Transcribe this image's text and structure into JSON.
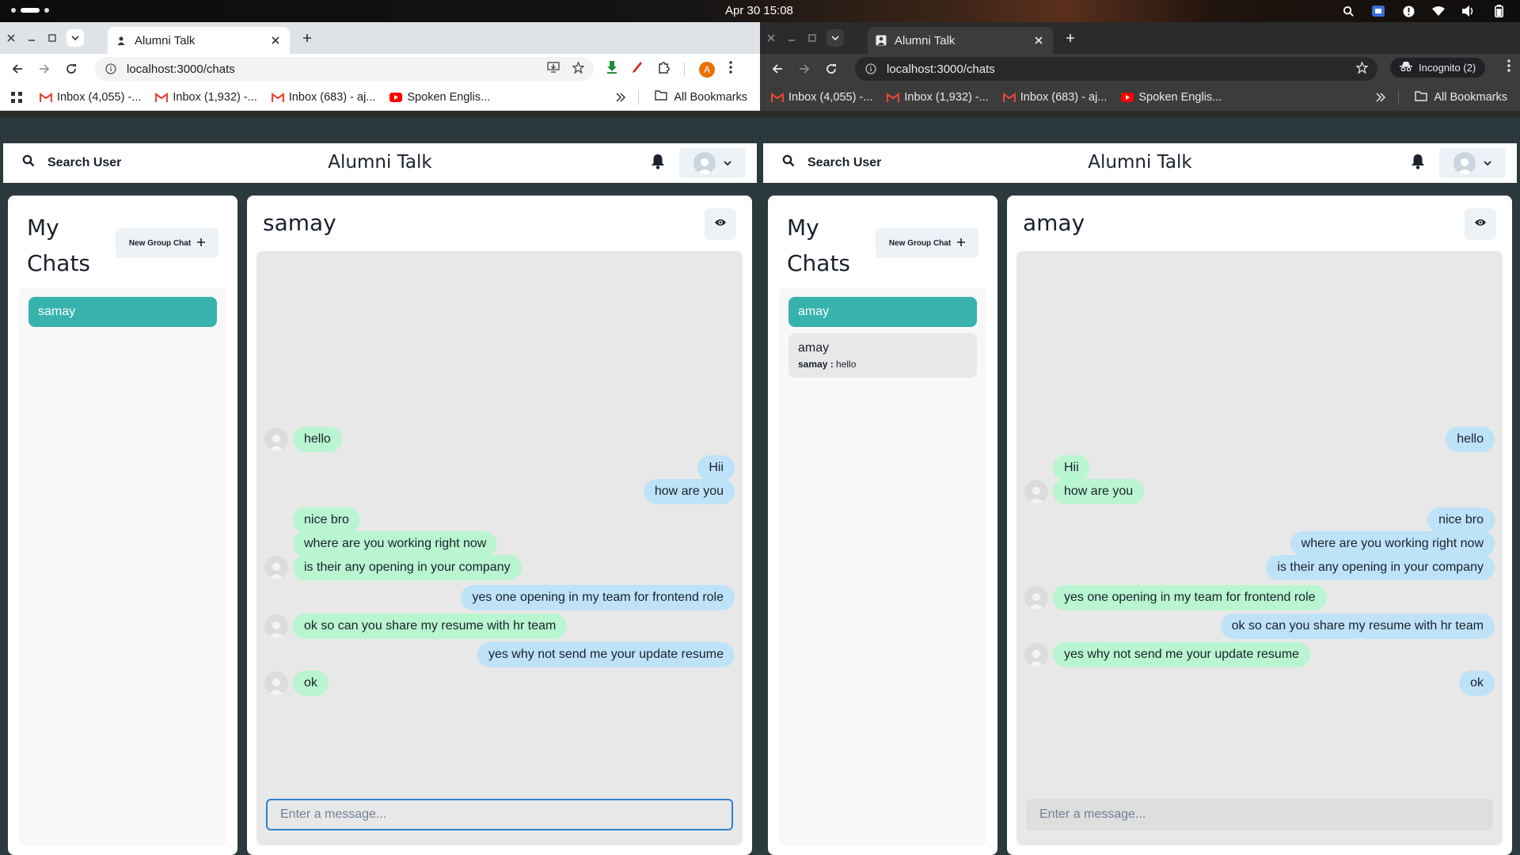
{
  "os": {
    "clock": "Apr 30  15:08",
    "tray_icons": [
      "search-icon",
      "network-app-icon",
      "info-icon",
      "wifi-icon",
      "volume-icon",
      "battery-icon"
    ]
  },
  "left_window": {
    "tab": {
      "title": "Alumni Talk"
    },
    "url": "localhost:3000/chats",
    "profile_initial": "A",
    "bookmarks": [
      "Inbox (4,055) -...",
      "Inbox (1,932) -...",
      "Inbox (683) - aj...",
      "Spoken Englis..."
    ],
    "all_bookmarks": "All Bookmarks",
    "app": {
      "search_label": "Search User",
      "title": "Alumni Talk",
      "my_chats_title": "My Chats",
      "new_group_label": "New Group Chat",
      "chats": [
        {
          "name": "samay",
          "active": true
        }
      ],
      "conversation": {
        "title": "samay",
        "input_placeholder": "Enter a message...",
        "messages": [
          {
            "text": "hello",
            "from": "other",
            "avatar": true
          },
          {
            "text": "Hii",
            "from": "self"
          },
          {
            "text": "how are you",
            "from": "self"
          },
          {
            "text": "nice bro",
            "from": "other",
            "avatar": false
          },
          {
            "text": "where are you working right now",
            "from": "other",
            "avatar": false
          },
          {
            "text": "is their any opening in your company",
            "from": "other",
            "avatar": true
          },
          {
            "text": "yes one opening in my team for frontend role",
            "from": "self"
          },
          {
            "text": "ok so can you share my resume with hr team",
            "from": "other",
            "avatar": true
          },
          {
            "text": "yes why not send me your update resume",
            "from": "self"
          },
          {
            "text": "ok",
            "from": "other",
            "avatar": true
          }
        ]
      }
    }
  },
  "right_window": {
    "tab": {
      "title": "Alumni Talk"
    },
    "url": "localhost:3000/chats",
    "incognito_label": "Incognito (2)",
    "bookmarks": [
      "Inbox (4,055) -...",
      "Inbox (1,932) -...",
      "Inbox (683) - aj...",
      "Spoken Englis..."
    ],
    "all_bookmarks": "All Bookmarks",
    "app": {
      "search_label": "Search User",
      "title": "Alumni Talk",
      "my_chats_title": "My Chats",
      "new_group_label": "New Group Chat",
      "chats": [
        {
          "name": "amay",
          "active": true
        },
        {
          "name": "amay",
          "active": false,
          "latest_sender": "samay :",
          "latest_text": "hello"
        }
      ],
      "conversation": {
        "title": "amay",
        "input_placeholder": "Enter a message...",
        "messages": [
          {
            "text": "hello",
            "from": "self"
          },
          {
            "text": "Hii",
            "from": "other",
            "avatar": false
          },
          {
            "text": "how are you",
            "from": "other",
            "avatar": true
          },
          {
            "text": "nice bro",
            "from": "self"
          },
          {
            "text": "where are you working right now",
            "from": "self"
          },
          {
            "text": "is their any opening in your company",
            "from": "self"
          },
          {
            "text": "yes one opening in my team for frontend role",
            "from": "other",
            "avatar": true
          },
          {
            "text": "ok so can you share my resume with hr team",
            "from": "self"
          },
          {
            "text": "yes why not send me your update resume",
            "from": "other",
            "avatar": true
          },
          {
            "text": "ok",
            "from": "self"
          }
        ]
      }
    }
  },
  "colors": {
    "accent_teal": "#38b2ac",
    "bubble_other": "#b9f5d0",
    "bubble_self": "#bee3f8",
    "page_bg": "#2d3a3d"
  }
}
